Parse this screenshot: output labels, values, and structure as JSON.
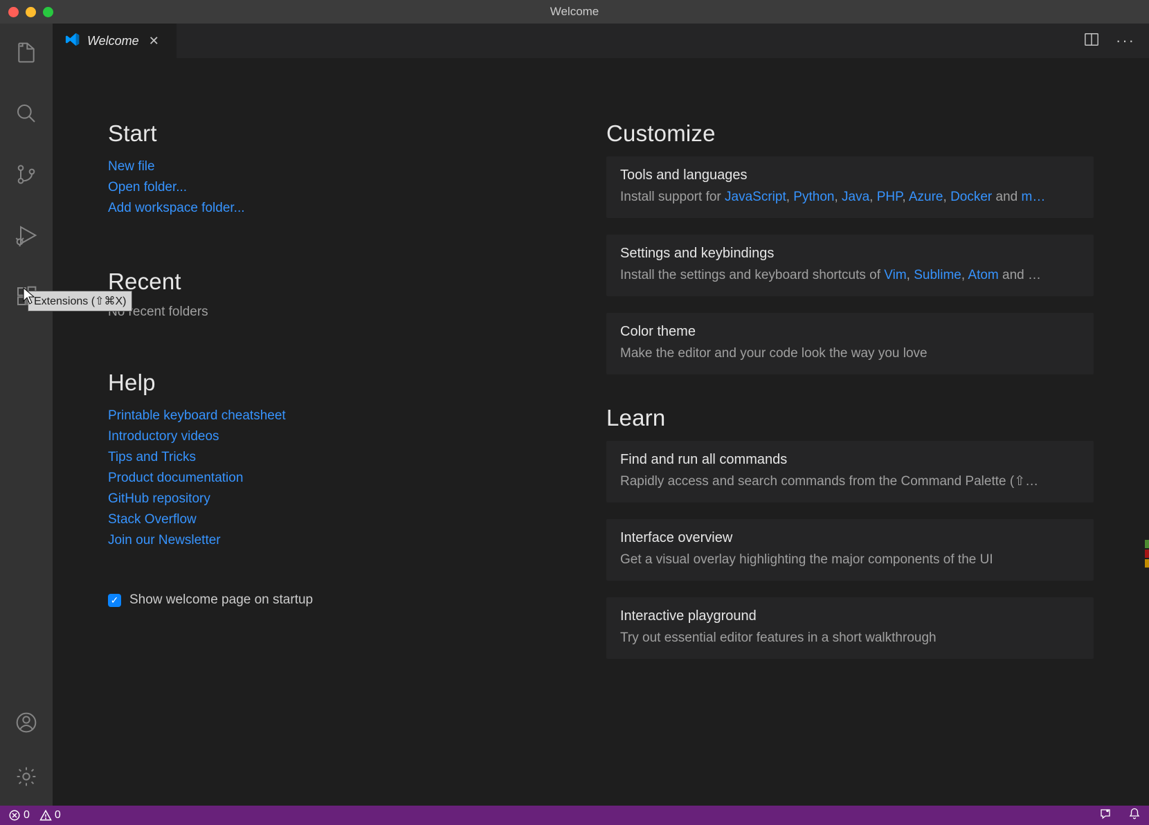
{
  "window": {
    "title": "Welcome"
  },
  "tab": {
    "label": "Welcome"
  },
  "tooltip": {
    "text": "Extensions (⇧⌘X)"
  },
  "start": {
    "heading": "Start",
    "new_file": "New file",
    "open_folder": "Open folder...",
    "add_workspace": "Add workspace folder..."
  },
  "recent": {
    "heading": "Recent",
    "empty": "No recent folders"
  },
  "help": {
    "heading": "Help",
    "cheatsheet": "Printable keyboard cheatsheet",
    "videos": "Introductory videos",
    "tips": "Tips and Tricks",
    "docs": "Product documentation",
    "github": "GitHub repository",
    "stack": "Stack Overflow",
    "newsletter": "Join our Newsletter"
  },
  "startup_checkbox": {
    "label": "Show welcome page on startup"
  },
  "customize": {
    "heading": "Customize",
    "tools": {
      "title": "Tools and languages",
      "prefix": "Install support for ",
      "js": "JavaScript",
      "py": "Python",
      "java": "Java",
      "php": "PHP",
      "azure": "Azure",
      "docker": "Docker",
      "and": " and ",
      "more": "m…",
      "sep": ", "
    },
    "settings": {
      "title": "Settings and keybindings",
      "prefix": "Install the settings and keyboard shortcuts of ",
      "vim": "Vim",
      "sublime": "Sublime",
      "atom": "Atom",
      "and": " and …",
      "sep": ", "
    },
    "theme": {
      "title": "Color theme",
      "desc": "Make the editor and your code look the way you love"
    }
  },
  "learn": {
    "heading": "Learn",
    "commands": {
      "title": "Find and run all commands",
      "desc": "Rapidly access and search commands from the Command Palette (⇧…"
    },
    "overview": {
      "title": "Interface overview",
      "desc": "Get a visual overlay highlighting the major components of the UI"
    },
    "playground": {
      "title": "Interactive playground",
      "desc": "Try out essential editor features in a short walkthrough"
    }
  },
  "status": {
    "errors": "0",
    "warnings": "0"
  }
}
